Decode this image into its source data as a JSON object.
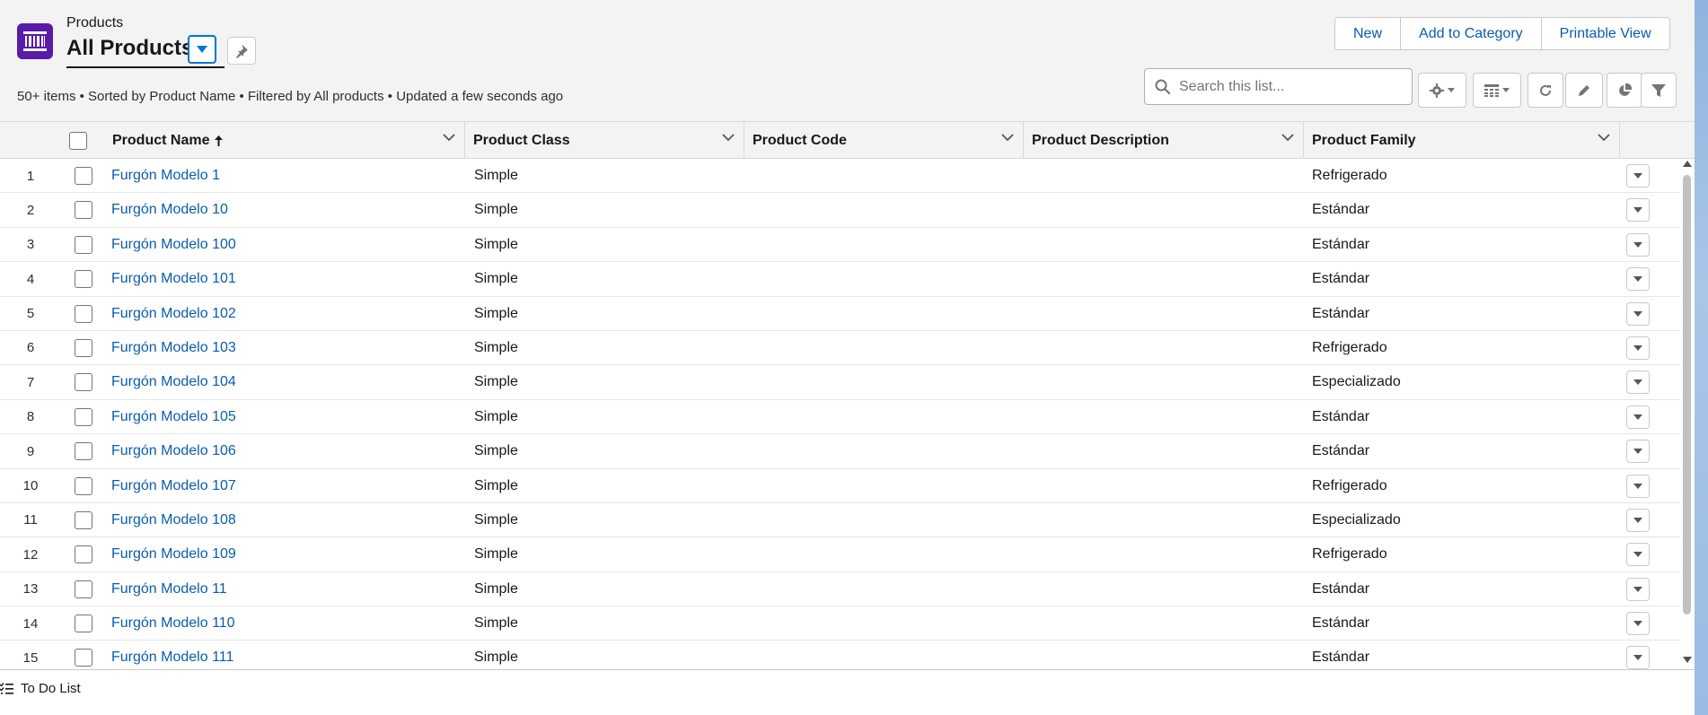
{
  "header": {
    "object_label": "Products",
    "list_title": "All Products",
    "status_line": "50+ items • Sorted by Product Name • Filtered by All products • Updated a few seconds ago",
    "buttons": {
      "new": "New",
      "add_to_category": "Add to Category",
      "printable_view": "Printable View"
    },
    "search": {
      "placeholder": "Search this list...",
      "value": ""
    },
    "accent_color": "#5a1ba9",
    "link_color": "#0b5cab"
  },
  "toolbar": {
    "icons": [
      "gear-icon",
      "table-display-icon",
      "refresh-icon",
      "edit-icon",
      "chart-icon",
      "filter-icon"
    ]
  },
  "table": {
    "columns": {
      "product_name": "Product Name",
      "product_class": "Product Class",
      "product_code": "Product Code",
      "product_description": "Product Description",
      "product_family": "Product Family"
    },
    "sort_column": "Product Name",
    "sort_direction": "ascending",
    "rows": [
      {
        "num": "1",
        "name": "Furgón Modelo 1",
        "class": "Simple",
        "code": "",
        "description": "",
        "family": "Refrigerado"
      },
      {
        "num": "2",
        "name": "Furgón Modelo 10",
        "class": "Simple",
        "code": "",
        "description": "",
        "family": "Estándar"
      },
      {
        "num": "3",
        "name": "Furgón Modelo 100",
        "class": "Simple",
        "code": "",
        "description": "",
        "family": "Estándar"
      },
      {
        "num": "4",
        "name": "Furgón Modelo 101",
        "class": "Simple",
        "code": "",
        "description": "",
        "family": "Estándar"
      },
      {
        "num": "5",
        "name": "Furgón Modelo 102",
        "class": "Simple",
        "code": "",
        "description": "",
        "family": "Estándar"
      },
      {
        "num": "6",
        "name": "Furgón Modelo 103",
        "class": "Simple",
        "code": "",
        "description": "",
        "family": "Refrigerado"
      },
      {
        "num": "7",
        "name": "Furgón Modelo 104",
        "class": "Simple",
        "code": "",
        "description": "",
        "family": "Especializado"
      },
      {
        "num": "8",
        "name": "Furgón Modelo 105",
        "class": "Simple",
        "code": "",
        "description": "",
        "family": "Estándar"
      },
      {
        "num": "9",
        "name": "Furgón Modelo 106",
        "class": "Simple",
        "code": "",
        "description": "",
        "family": "Estándar"
      },
      {
        "num": "10",
        "name": "Furgón Modelo 107",
        "class": "Simple",
        "code": "",
        "description": "",
        "family": "Refrigerado"
      },
      {
        "num": "11",
        "name": "Furgón Modelo 108",
        "class": "Simple",
        "code": "",
        "description": "",
        "family": "Especializado"
      },
      {
        "num": "12",
        "name": "Furgón Modelo 109",
        "class": "Simple",
        "code": "",
        "description": "",
        "family": "Refrigerado"
      },
      {
        "num": "13",
        "name": "Furgón Modelo 11",
        "class": "Simple",
        "code": "",
        "description": "",
        "family": "Estándar"
      },
      {
        "num": "14",
        "name": "Furgón Modelo 110",
        "class": "Simple",
        "code": "",
        "description": "",
        "family": "Estándar"
      },
      {
        "num": "15",
        "name": "Furgón Modelo 111",
        "class": "Simple",
        "code": "",
        "description": "",
        "family": "Estándar"
      }
    ]
  },
  "utility_bar": {
    "todo_label": "To Do List"
  }
}
